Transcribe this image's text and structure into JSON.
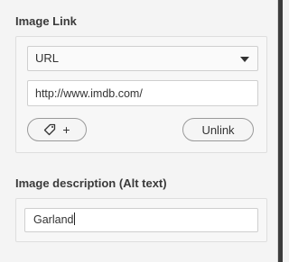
{
  "image_link": {
    "label": "Image Link",
    "link_type": {
      "selected": "URL"
    },
    "url_value": "http://www.imdb.com/",
    "tag_button": {
      "plus": "+"
    },
    "unlink_label": "Unlink"
  },
  "alt_text": {
    "label": "Image description (Alt text)",
    "value": "Garland"
  },
  "icons": {
    "dropdown": "chevron-down-icon",
    "tag": "tag-icon"
  }
}
